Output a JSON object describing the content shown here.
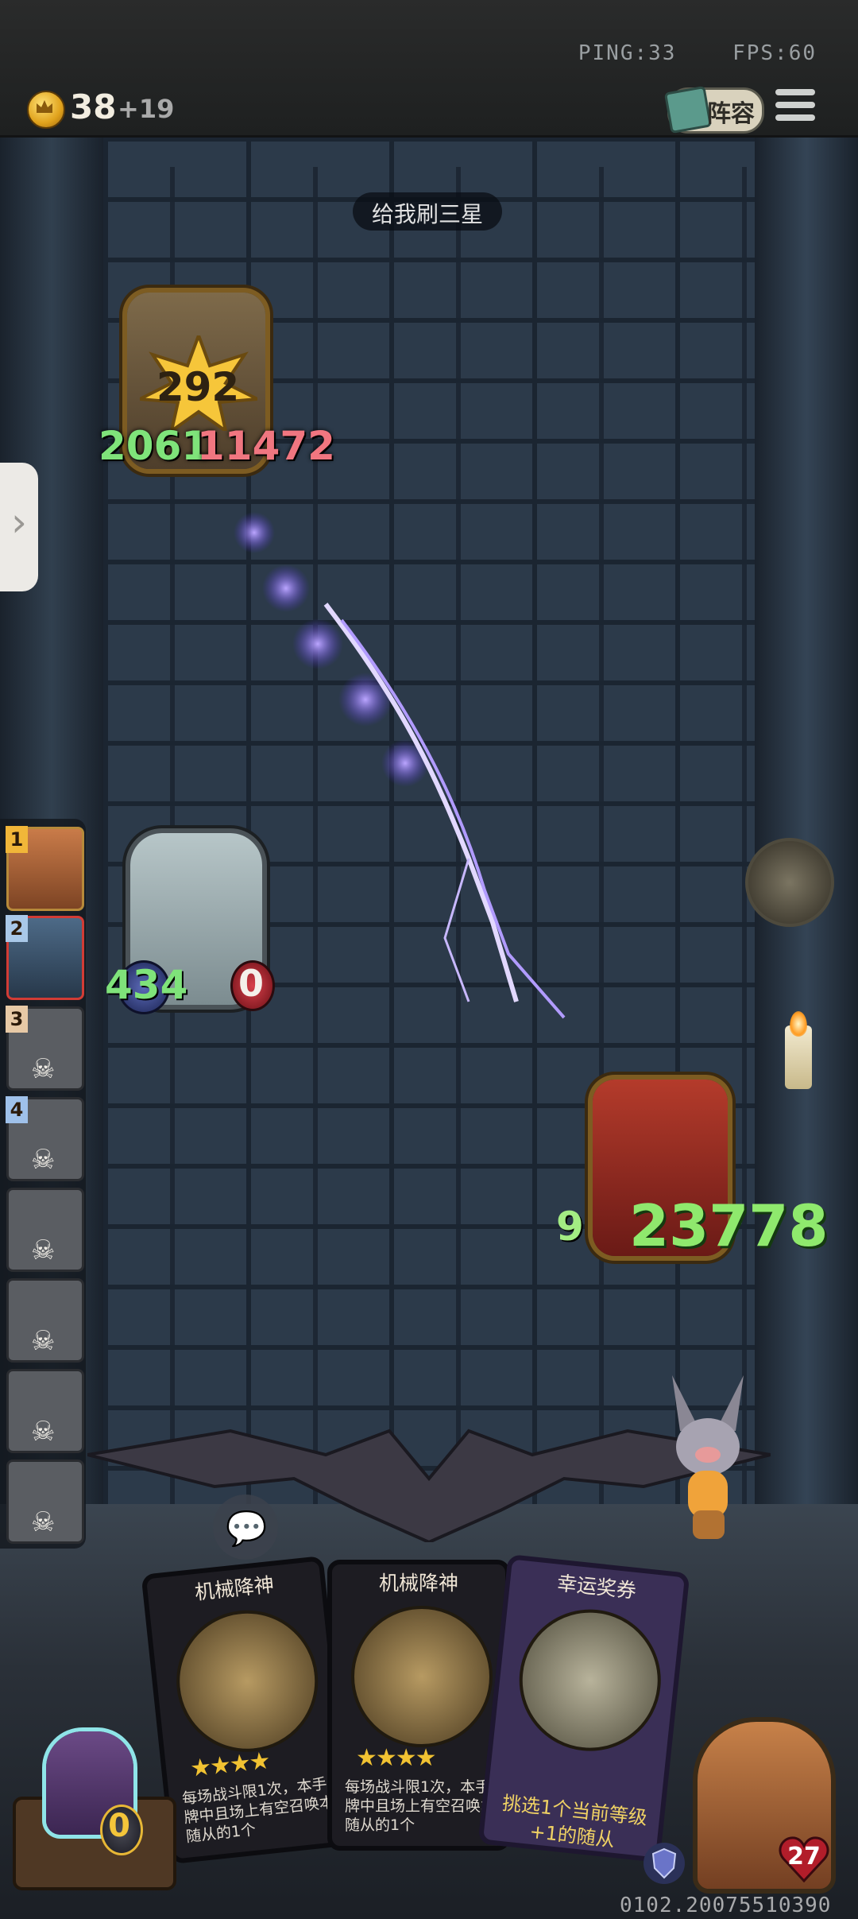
{
  "status": {
    "ping": "PING:33",
    "fps": "FPS:60"
  },
  "header": {
    "gold": "38",
    "gold_income": "+19",
    "lineup_label": "阵容"
  },
  "board": {
    "banner": "给我刷三星",
    "enemy": {
      "score": "292",
      "attack": "2061",
      "health": "11472"
    },
    "ally": {
      "attack": "434",
      "health": "0"
    },
    "boss": {
      "attack": "9",
      "health": "23778"
    }
  },
  "roster": [
    {
      "rank": "1",
      "alive": true
    },
    {
      "rank": "2",
      "alive": true
    },
    {
      "rank": "3",
      "alive": false
    },
    {
      "rank": "4",
      "alive": false
    },
    {
      "rank": "",
      "alive": false
    },
    {
      "rank": "",
      "alive": false
    },
    {
      "rank": "",
      "alive": false
    },
    {
      "rank": "",
      "alive": false
    }
  ],
  "hand": [
    {
      "title": "机械降神",
      "stars": "★★★★",
      "desc": "每场战斗限1次，本手牌中且场上有空召唤本随从的1个"
    },
    {
      "title": "机械降神",
      "stars": "★★★★",
      "desc": "每场战斗限1次，本手牌中且场上有空召唤本随从的1个"
    },
    {
      "title": "幸运奖券",
      "stars": "",
      "desc": "挑选1个当前等级+1的随从"
    }
  ],
  "tavern": {
    "cost": "0"
  },
  "hero": {
    "health": "27"
  },
  "build_id": "0102.20075510390",
  "colors": {
    "attack_green": "#7fe37a",
    "health_red": "#f07680",
    "gold": "#f4c53a"
  }
}
